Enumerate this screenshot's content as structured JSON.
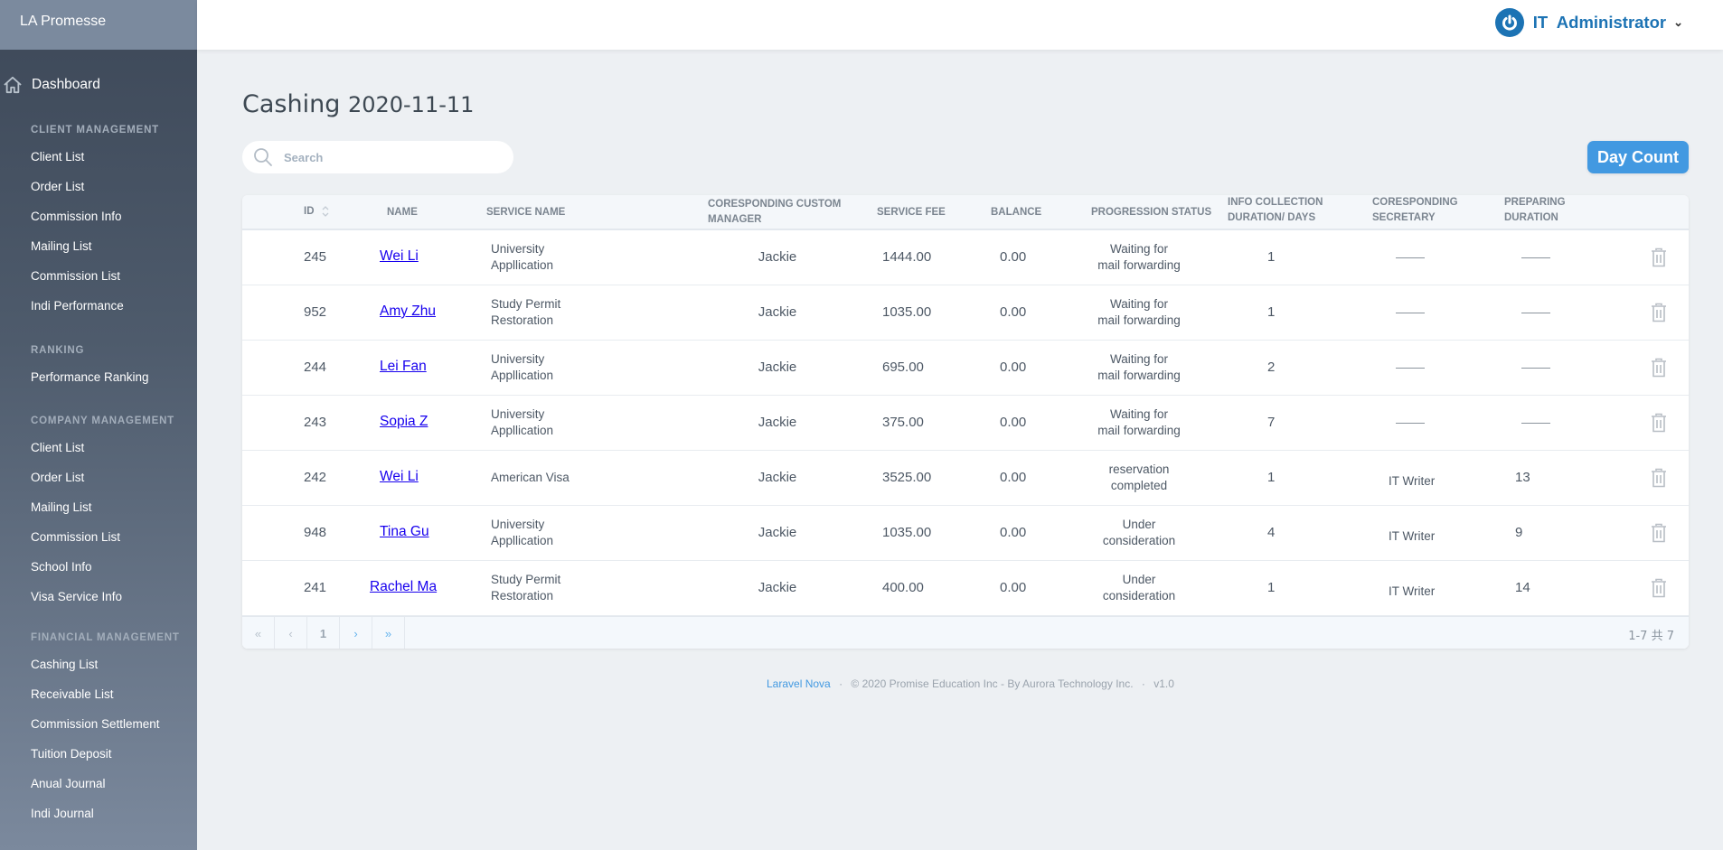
{
  "brand": "LA Promesse",
  "nav": {
    "dashboard": "Dashboard",
    "sections": [
      {
        "title": "CLIENT MANAGEMENT",
        "items": [
          "Client List",
          "Order List",
          "Commission Info",
          "Mailing List",
          "Commission List",
          "Indi Performance"
        ]
      },
      {
        "title": "RANKING",
        "items": [
          "Performance Ranking"
        ]
      },
      {
        "title": "COMPANY MANAGEMENT",
        "items": [
          "Client List",
          "Order List",
          "Mailing List",
          "Commission List",
          "School Info",
          "Visa Service Info"
        ]
      },
      {
        "title": "FINANCIAL MANAGEMENT",
        "items": [
          "Cashing List",
          "Receivable List",
          "Commission Settlement",
          "Tuition Deposit",
          "Anual Journal",
          "Indi Journal"
        ]
      }
    ]
  },
  "user": {
    "name": "IT  Administrator",
    "accent": "#1c73b4"
  },
  "page": {
    "title": "Cashing",
    "date": "2020-11-11"
  },
  "search": {
    "placeholder": "Search",
    "value": ""
  },
  "day_count_label": "Day Count",
  "table": {
    "headers": {
      "id": "ID",
      "name": "NAME",
      "service": "SERVICE NAME",
      "manager_1": "CORESPONDING CUSTOM",
      "manager_2": "MANAGER",
      "fee": "SERVICE FEE",
      "balance": "BALANCE",
      "status": "PROGRESSION STATUS",
      "info_1": "INFO COLLECTION",
      "info_2": "DURATION/ DAYS",
      "secretary_1": "CORESPONDING",
      "secretary_2": "SECRETARY",
      "prep_1": "PREPARING",
      "prep_2": "DURATION"
    },
    "rows": [
      {
        "id": "245",
        "name": "Wei Li",
        "service_1": "University",
        "service_2": "Appllication",
        "manager": "Jackie",
        "fee": "1444.00",
        "balance": "0.00",
        "status_1": "Waiting for",
        "status_2": "mail forwarding",
        "info": "1",
        "secretary": "——",
        "prep": "——"
      },
      {
        "id": "952",
        "name": "Amy Zhu",
        "service_1": "Study Permit",
        "service_2": "Restoration",
        "manager": "Jackie",
        "fee": "1035.00",
        "balance": "0.00",
        "status_1": "Waiting for",
        "status_2": "mail forwarding",
        "info": "1",
        "secretary": "——",
        "prep": "——"
      },
      {
        "id": "244",
        "name": "Lei Fan",
        "service_1": "University",
        "service_2": "Appllication",
        "manager": "Jackie",
        "fee": "695.00",
        "balance": "0.00",
        "status_1": "Waiting for",
        "status_2": "mail forwarding",
        "info": "2",
        "secretary": "——",
        "prep": "——"
      },
      {
        "id": "243",
        "name": "Sopia Z",
        "service_1": "University",
        "service_2": "Appllication",
        "manager": "Jackie",
        "fee": "375.00",
        "balance": "0.00",
        "status_1": "Waiting for",
        "status_2": "mail forwarding",
        "info": "7",
        "secretary": "——",
        "prep": "——"
      },
      {
        "id": "242",
        "name": "Wei Li",
        "service_1": "American Visa",
        "service_2": "",
        "manager": "Jackie",
        "fee": "3525.00",
        "balance": "0.00",
        "status_1": "reservation",
        "status_2": "completed",
        "info": "1",
        "secretary": "IT Writer",
        "prep": "13"
      },
      {
        "id": "948",
        "name": "Tina Gu",
        "service_1": "University",
        "service_2": "Appllication",
        "manager": "Jackie",
        "fee": "1035.00",
        "balance": "0.00",
        "status_1": "Under",
        "status_2": "consideration",
        "info": "4",
        "secretary": "IT Writer",
        "prep": "9"
      },
      {
        "id": "241",
        "name": "Rachel Ma",
        "service_1": "Study Permit",
        "service_2": "Restoration",
        "manager": "Jackie",
        "fee": "400.00",
        "balance": "0.00",
        "status_1": "Under",
        "status_2": "consideration",
        "info": "1",
        "secretary": "IT Writer",
        "prep": "14"
      }
    ]
  },
  "pagination": {
    "first": "«",
    "prev": "‹",
    "current": "1",
    "next": "›",
    "last": "»",
    "count": "1-7 共 7"
  },
  "footer": {
    "link": "Laravel Nova",
    "sep": "·",
    "copyright": "© 2020 Promise Education Inc - By Aurora Technology Inc.",
    "version": "v1.0"
  }
}
